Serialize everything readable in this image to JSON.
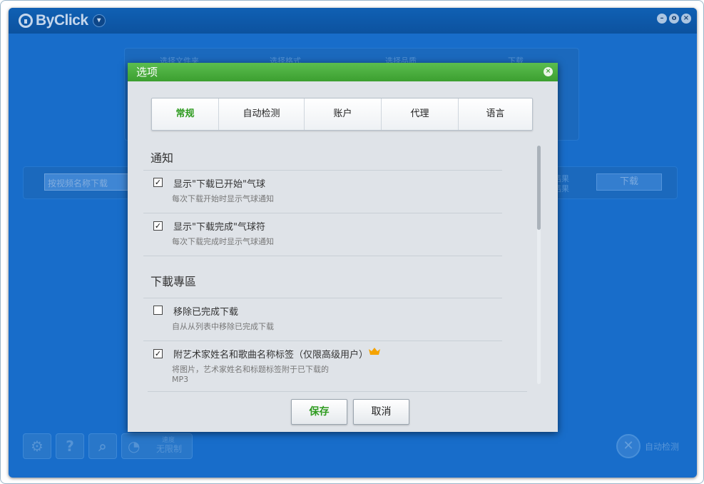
{
  "app": {
    "name": "ByClick",
    "window_buttons": [
      "–",
      "o",
      "×"
    ]
  },
  "background": {
    "steps": [
      "选择文件夹",
      "选择格式",
      "选择品质",
      "下载"
    ],
    "url_placeholder": "按视频名称下载",
    "download_label": "下载",
    "side_labels": [
      "结果",
      "结果"
    ],
    "speed_label": "无限制",
    "speed_top": "速度",
    "auto_detect_label": "自动检测",
    "tools": [
      "settings-icon",
      "help-icon",
      "search-icon",
      "speed-icon"
    ]
  },
  "dialog": {
    "title": "选项",
    "tabs": [
      {
        "label": "常规",
        "active": true
      },
      {
        "label": "自动检测",
        "active": false
      },
      {
        "label": "账户",
        "active": false
      },
      {
        "label": "代理",
        "active": false
      },
      {
        "label": "语言",
        "active": false
      }
    ],
    "sections": [
      {
        "title": "通知",
        "options": [
          {
            "label": "显示\"下载已开始\"气球",
            "desc": "每次下载开始时显示气球通知",
            "checked": true
          },
          {
            "label": "显示\"下载完成\"气球符",
            "desc": "每次下载完成时显示气球通知",
            "checked": true
          }
        ]
      },
      {
        "title": "下載專區",
        "options": [
          {
            "label": "移除已完成下载",
            "desc": "自从从列表中移除已完成下载",
            "checked": false
          },
          {
            "label": "附艺术家姓名和歌曲名称标签（仅限高级用户）",
            "desc": "将图片，艺术家姓名和标题标签附于已下载的MP3",
            "checked": true,
            "premium": true
          }
        ]
      }
    ],
    "buttons": {
      "save": "保存",
      "cancel": "取消"
    }
  },
  "colors": {
    "accent_green": "#2e9b1f",
    "title_green": "#4cb040",
    "app_blue": "#1a73d2",
    "crown": "#f5a300"
  }
}
